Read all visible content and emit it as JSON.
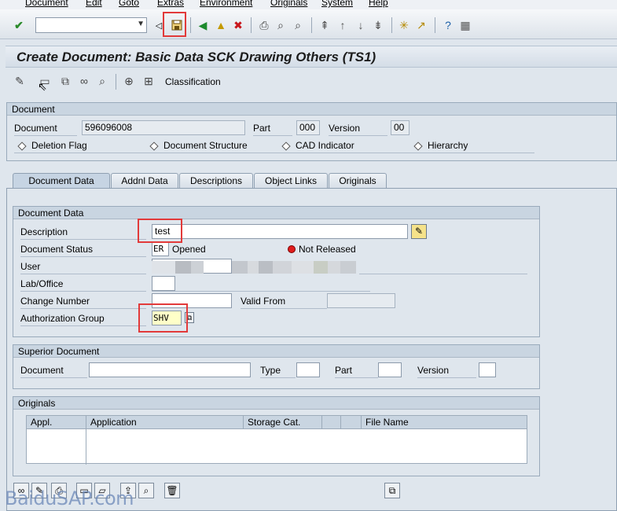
{
  "menu": [
    "Document",
    "Edit",
    "Goto",
    "Extras",
    "Environment",
    "Originals",
    "System",
    "Help"
  ],
  "title": "Create Document: Basic Data SCK Drawing Others (TS1)",
  "app_toolbar": {
    "classification_label": "Classification"
  },
  "document_group": {
    "title": "Document",
    "document_label": "Document",
    "document_value": "596096008",
    "part_label": "Part",
    "part_value": "000",
    "version_label": "Version",
    "version_value": "00",
    "flags": [
      "Deletion Flag",
      "Document Structure",
      "CAD Indicator",
      "Hierarchy"
    ]
  },
  "tabs": [
    "Document Data",
    "Addnl Data",
    "Descriptions",
    "Object Links",
    "Originals"
  ],
  "document_data": {
    "title": "Document Data",
    "description_label": "Description",
    "description_value": "test",
    "status_label": "Document Status",
    "status_code": "ER",
    "status_text": "Opened",
    "release_text": "Not Released",
    "user_label": "User",
    "lab_label": "Lab/Office",
    "change_number_label": "Change Number",
    "valid_from_label": "Valid From",
    "auth_group_label": "Authorization Group",
    "auth_group_value": "SHV"
  },
  "superior_document": {
    "title": "Superior Document",
    "document_label": "Document",
    "type_label": "Type",
    "part_label": "Part",
    "version_label": "Version"
  },
  "originals": {
    "title": "Originals",
    "columns": [
      "Appl.",
      "Application",
      "Storage Cat.",
      "",
      "File Name"
    ]
  },
  "watermark": "BaiduSAP.com",
  "colors": {
    "highlight": "#e23a3a",
    "title_bg": "#d4dde7",
    "field_bg": "#ffffff"
  }
}
